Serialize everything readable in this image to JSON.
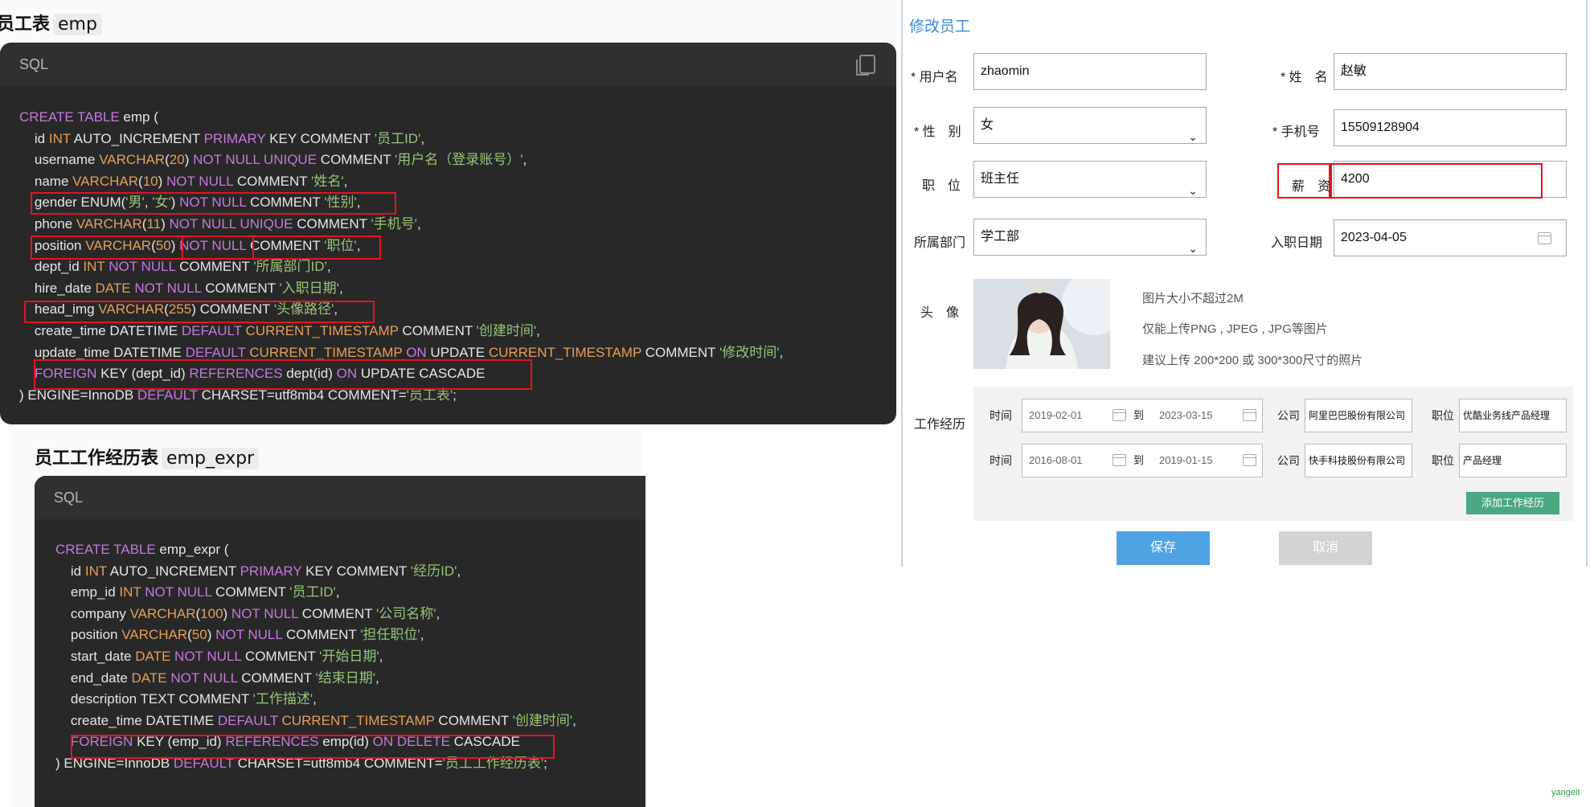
{
  "doc1": {
    "title": "员工表",
    "chip": "emp",
    "lang": "SQL",
    "lines": [
      [
        {
          "t": "CREATE TABLE",
          "c": "kw"
        },
        {
          "t": " emp ("
        }
      ],
      [
        {
          "t": "    id "
        },
        {
          "t": "INT",
          "c": "ty"
        },
        {
          "t": " AUTO_INCREMENT "
        },
        {
          "t": "PRIMARY",
          "c": "kw"
        },
        {
          "t": " KEY COMMENT "
        },
        {
          "t": "'员工ID'",
          "c": "st"
        },
        {
          "t": ","
        }
      ],
      [
        {
          "t": "    username "
        },
        {
          "t": "VARCHAR",
          "c": "ty"
        },
        {
          "t": "("
        },
        {
          "t": "20",
          "c": "ty"
        },
        {
          "t": ") "
        },
        {
          "t": "NOT NULL UNIQUE",
          "c": "kw"
        },
        {
          "t": " COMMENT "
        },
        {
          "t": "'用户名（登录账号）'",
          "c": "st"
        },
        {
          "t": ","
        }
      ],
      [
        {
          "t": "    name "
        },
        {
          "t": "VARCHAR",
          "c": "ty"
        },
        {
          "t": "("
        },
        {
          "t": "10",
          "c": "ty"
        },
        {
          "t": ") "
        },
        {
          "t": "NOT NULL",
          "c": "kw"
        },
        {
          "t": " COMMENT "
        },
        {
          "t": "'姓名'",
          "c": "st"
        },
        {
          "t": ","
        }
      ],
      [
        {
          "t": "    gender ENUM("
        },
        {
          "t": "'男'",
          "c": "st"
        },
        {
          "t": ", "
        },
        {
          "t": "'女'",
          "c": "st"
        },
        {
          "t": ") "
        },
        {
          "t": "NOT NULL",
          "c": "kw"
        },
        {
          "t": " COMMENT "
        },
        {
          "t": "'性别'",
          "c": "st"
        },
        {
          "t": ","
        }
      ],
      [
        {
          "t": "    phone "
        },
        {
          "t": "VARCHAR",
          "c": "ty"
        },
        {
          "t": "("
        },
        {
          "t": "11",
          "c": "ty"
        },
        {
          "t": ") "
        },
        {
          "t": "NOT NULL UNIQUE",
          "c": "kw"
        },
        {
          "t": " COMMENT "
        },
        {
          "t": "'手机号'",
          "c": "st"
        },
        {
          "t": ","
        }
      ],
      [
        {
          "t": "    position "
        },
        {
          "t": "VARCHAR",
          "c": "ty"
        },
        {
          "t": "("
        },
        {
          "t": "50",
          "c": "ty"
        },
        {
          "t": ") "
        },
        {
          "t": "NOT NULL",
          "c": "kw"
        },
        {
          "t": " COMMENT "
        },
        {
          "t": "'职位'",
          "c": "st"
        },
        {
          "t": ","
        }
      ],
      [
        {
          "t": "    dept_id "
        },
        {
          "t": "INT",
          "c": "ty"
        },
        {
          "t": " "
        },
        {
          "t": "NOT NULL",
          "c": "kw"
        },
        {
          "t": " COMMENT "
        },
        {
          "t": "'所属部门ID'",
          "c": "st"
        },
        {
          "t": ","
        }
      ],
      [
        {
          "t": "    hire_date "
        },
        {
          "t": "DATE",
          "c": "ty"
        },
        {
          "t": " "
        },
        {
          "t": "NOT NULL",
          "c": "kw"
        },
        {
          "t": " COMMENT "
        },
        {
          "t": "'入职日期'",
          "c": "st"
        },
        {
          "t": ","
        }
      ],
      [
        {
          "t": "    head_img "
        },
        {
          "t": "VARCHAR",
          "c": "ty"
        },
        {
          "t": "("
        },
        {
          "t": "255",
          "c": "ty"
        },
        {
          "t": ") COMMENT "
        },
        {
          "t": "'头像路径'",
          "c": "st"
        },
        {
          "t": ","
        }
      ],
      [
        {
          "t": "    create_time DATETIME "
        },
        {
          "t": "DEFAULT",
          "c": "kw"
        },
        {
          "t": " "
        },
        {
          "t": "CURRENT_TIMESTAMP",
          "c": "ty"
        },
        {
          "t": " COMMENT "
        },
        {
          "t": "'创建时间'",
          "c": "st"
        },
        {
          "t": ","
        }
      ],
      [
        {
          "t": "    update_time DATETIME "
        },
        {
          "t": "DEFAULT",
          "c": "kw"
        },
        {
          "t": " "
        },
        {
          "t": "CURRENT_TIMESTAMP",
          "c": "ty"
        },
        {
          "t": " "
        },
        {
          "t": "ON",
          "c": "kw"
        },
        {
          "t": " UPDATE "
        },
        {
          "t": "CURRENT_TIMESTAMP",
          "c": "ty"
        },
        {
          "t": " COMMENT "
        },
        {
          "t": "'修改时间'",
          "c": "st"
        },
        {
          "t": ","
        }
      ],
      [
        {
          "t": "    "
        },
        {
          "t": "FOREIGN",
          "c": "kw"
        },
        {
          "t": " KEY (dept_id) "
        },
        {
          "t": "REFERENCES",
          "c": "kw"
        },
        {
          "t": " dept(id) "
        },
        {
          "t": "ON",
          "c": "kw"
        },
        {
          "t": " UPDATE CASCADE"
        }
      ],
      [
        {
          "t": ") ENGINE=InnoDB "
        },
        {
          "t": "DEFAULT",
          "c": "kw"
        },
        {
          "t": " CHARSET=utf8mb4 COMMENT="
        },
        {
          "t": "'员工表'",
          "c": "st"
        },
        {
          "t": ";"
        }
      ]
    ]
  },
  "doc2": {
    "title": "员工工作经历表",
    "chip": "emp_expr",
    "lang": "SQL",
    "lines": [
      [
        {
          "t": "CREATE TABLE",
          "c": "kw"
        },
        {
          "t": " emp_expr ("
        }
      ],
      [
        {
          "t": "    id "
        },
        {
          "t": "INT",
          "c": "ty"
        },
        {
          "t": " AUTO_INCREMENT "
        },
        {
          "t": "PRIMARY",
          "c": "kw"
        },
        {
          "t": " KEY COMMENT "
        },
        {
          "t": "'经历ID'",
          "c": "st"
        },
        {
          "t": ","
        }
      ],
      [
        {
          "t": "    emp_id "
        },
        {
          "t": "INT",
          "c": "ty"
        },
        {
          "t": " "
        },
        {
          "t": "NOT NULL",
          "c": "kw"
        },
        {
          "t": " COMMENT "
        },
        {
          "t": "'员工ID'",
          "c": "st"
        },
        {
          "t": ","
        }
      ],
      [
        {
          "t": "    company "
        },
        {
          "t": "VARCHAR",
          "c": "ty"
        },
        {
          "t": "("
        },
        {
          "t": "100",
          "c": "ty"
        },
        {
          "t": ") "
        },
        {
          "t": "NOT NULL",
          "c": "kw"
        },
        {
          "t": " COMMENT "
        },
        {
          "t": "'公司名称'",
          "c": "st"
        },
        {
          "t": ","
        }
      ],
      [
        {
          "t": "    position "
        },
        {
          "t": "VARCHAR",
          "c": "ty"
        },
        {
          "t": "("
        },
        {
          "t": "50",
          "c": "ty"
        },
        {
          "t": ") "
        },
        {
          "t": "NOT NULL",
          "c": "kw"
        },
        {
          "t": " COMMENT "
        },
        {
          "t": "'担任职位'",
          "c": "st"
        },
        {
          "t": ","
        }
      ],
      [
        {
          "t": "    start_date "
        },
        {
          "t": "DATE",
          "c": "ty"
        },
        {
          "t": " "
        },
        {
          "t": "NOT NULL",
          "c": "kw"
        },
        {
          "t": " COMMENT "
        },
        {
          "t": "'开始日期'",
          "c": "st"
        },
        {
          "t": ","
        }
      ],
      [
        {
          "t": "    end_date "
        },
        {
          "t": "DATE",
          "c": "ty"
        },
        {
          "t": " "
        },
        {
          "t": "NOT NULL",
          "c": "kw"
        },
        {
          "t": " COMMENT "
        },
        {
          "t": "'结束日期'",
          "c": "st"
        },
        {
          "t": ","
        }
      ],
      [
        {
          "t": "    description TEXT COMMENT "
        },
        {
          "t": "'工作描述'",
          "c": "st"
        },
        {
          "t": ","
        }
      ],
      [
        {
          "t": "    create_time DATETIME "
        },
        {
          "t": "DEFAULT",
          "c": "kw"
        },
        {
          "t": " "
        },
        {
          "t": "CURRENT_TIMESTAMP",
          "c": "ty"
        },
        {
          "t": " COMMENT "
        },
        {
          "t": "'创建时间'",
          "c": "st"
        },
        {
          "t": ","
        }
      ],
      [
        {
          "t": "    "
        },
        {
          "t": "FOREIGN",
          "c": "kw"
        },
        {
          "t": " KEY (emp_id) "
        },
        {
          "t": "REFERENCES",
          "c": "kw"
        },
        {
          "t": " emp(id) "
        },
        {
          "t": "ON DELETE",
          "c": "kw"
        },
        {
          "t": " CASCADE"
        }
      ],
      [
        {
          "t": ") ENGINE=InnoDB "
        },
        {
          "t": "DEFAULT",
          "c": "kw"
        },
        {
          "t": " CHARSET=utf8mb4 COMMENT="
        },
        {
          "t": "'员工工作经历表'",
          "c": "st"
        },
        {
          "t": ";"
        }
      ]
    ]
  },
  "form": {
    "title": "修改员工",
    "username_label": "* 用户名",
    "username_value": "zhaomin",
    "name_label": "* 姓　名",
    "name_value": "赵敏",
    "gender_label": "* 性　别",
    "gender_value": "女",
    "phone_label": "* 手机号",
    "phone_value": "15509128904",
    "job_label": "职　位",
    "job_value": "班主任",
    "salary_label": "薪　资",
    "salary_value": "4200",
    "dept_label": "所属部门",
    "dept_value": "学工部",
    "hire_label": "入职日期",
    "hire_value": "2023-04-05",
    "avatar_label": "头　像",
    "avatar_hints": [
      "图片大小不超过2M",
      "仅能上传PNG , JPEG , JPG等图片",
      "建议上传 200*200 或 300*300尺寸的照片"
    ],
    "work_label": "工作经历",
    "expr": [
      {
        "time_label": "时间",
        "start": "2019-02-01",
        "to": "到",
        "end": "2023-03-15",
        "company_label": "公司",
        "company": "阿里巴巴股份有限公司",
        "position_label": "职位",
        "position": "优酷业务线产品经理"
      },
      {
        "time_label": "时间",
        "start": "2016-08-01",
        "to": "到",
        "end": "2019-01-15",
        "company_label": "公司",
        "company": "快手科技股份有限公司",
        "position_label": "职位",
        "position": "产品经理"
      }
    ],
    "add_expr": "添加工作经历",
    "save": "保存",
    "cancel": "取消",
    "colors": {
      "primary": "#4fa3e3",
      "green": "#4aa882",
      "disabled": "#d3d3d3",
      "title": "#3d86d6"
    }
  },
  "watermark": "yangeit"
}
